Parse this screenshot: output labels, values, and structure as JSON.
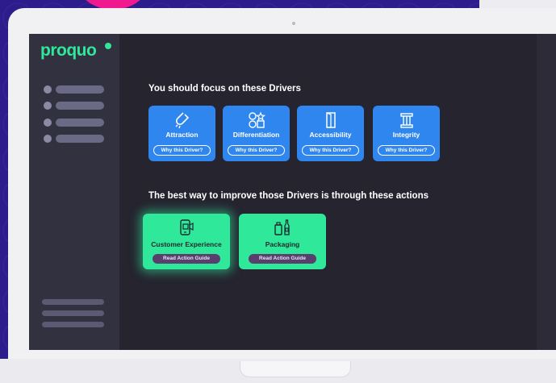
{
  "app": {
    "logo": "proquo"
  },
  "sections": {
    "drivers_heading": "You should focus on these Drivers",
    "actions_heading": "The best way to improve those Drivers is through these actions"
  },
  "drivers": [
    {
      "label": "Attraction",
      "button": "Why this Driver?",
      "icon": "magnet-icon"
    },
    {
      "label": "Differentiation",
      "button": "Why this Driver?",
      "icon": "shapes-icon"
    },
    {
      "label": "Accessibility",
      "button": "Why this Driver?",
      "icon": "door-icon"
    },
    {
      "label": "Integrity",
      "button": "Why this Driver?",
      "icon": "pillar-icon"
    }
  ],
  "actions": [
    {
      "label": "Customer Experience",
      "button": "Read Action Guide",
      "icon": "phone-video-icon"
    },
    {
      "label": "Packaging",
      "button": "Read Action Guide",
      "icon": "bottles-icon"
    }
  ],
  "colors": {
    "brand_green": "#2fe89a",
    "driver_blue": "#2f86ef",
    "screen_bg": "#25242f",
    "sidebar_bg": "#32313f",
    "guide_button": "#5a3e6e",
    "backdrop": "#2c1c8c",
    "accent_pink": "#f0198f"
  }
}
